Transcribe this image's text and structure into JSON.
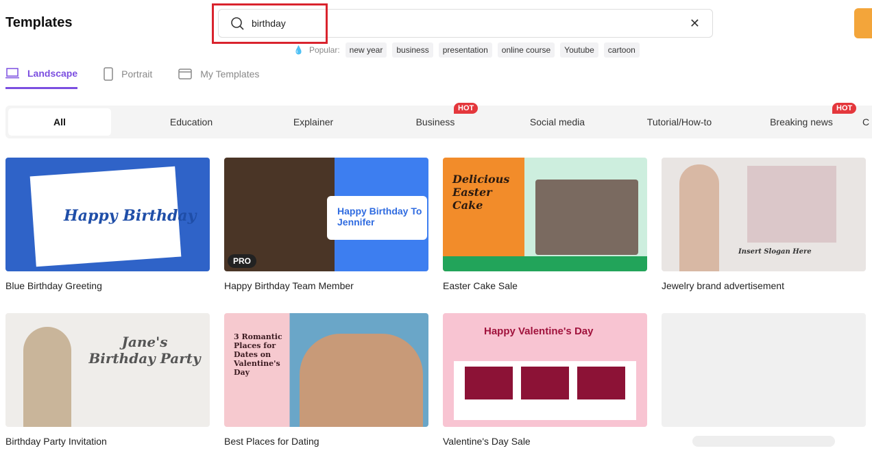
{
  "header": {
    "title": "Templates",
    "search_value": "birthday",
    "popular_label": "Popular:",
    "popular": [
      "new year",
      "business",
      "presentation",
      "online course",
      "Youtube",
      "cartoon"
    ]
  },
  "tabs": [
    {
      "label": "Landscape",
      "icon": "laptop-icon"
    },
    {
      "label": "Portrait",
      "icon": "phone-icon"
    },
    {
      "label": "My Templates",
      "icon": "folder-icon"
    }
  ],
  "categories": [
    {
      "label": "All"
    },
    {
      "label": "Education"
    },
    {
      "label": "Explainer"
    },
    {
      "label": "Business",
      "badge": "HOT"
    },
    {
      "label": "Social media"
    },
    {
      "label": "Tutorial/How-to"
    },
    {
      "label": "Breaking news",
      "badge": "HOT"
    },
    {
      "label": "C"
    }
  ],
  "cards": [
    {
      "title": "Blue Birthday Greeting",
      "thumb_text": "Happy Birthday",
      "bg": "#2f63c8"
    },
    {
      "title": "Happy Birthday Team Member",
      "thumb_text": "Happy Birthday To Jennifer",
      "bg": "#3d7ef0",
      "badge": "PRO"
    },
    {
      "title": "Easter Cake Sale",
      "thumb_text": "Delicious Easter Cake",
      "bg": "#f28c2a"
    },
    {
      "title": "Jewelry brand advertisement",
      "thumb_text": "Insert Slogan Here",
      "bg": "#e9e5e3"
    },
    {
      "title": "Birthday Party Invitation",
      "thumb_text": "Jane's Birthday Party",
      "bg": "#efedea"
    },
    {
      "title": "Best Places for Dating",
      "thumb_text": "3 Romantic Places for Dates on Valentine's Day",
      "bg": "#f6c9cf"
    },
    {
      "title": "Valentine's Day Sale",
      "thumb_text": "Happy Valentine's Day",
      "bg": "#f8c4d2"
    }
  ]
}
